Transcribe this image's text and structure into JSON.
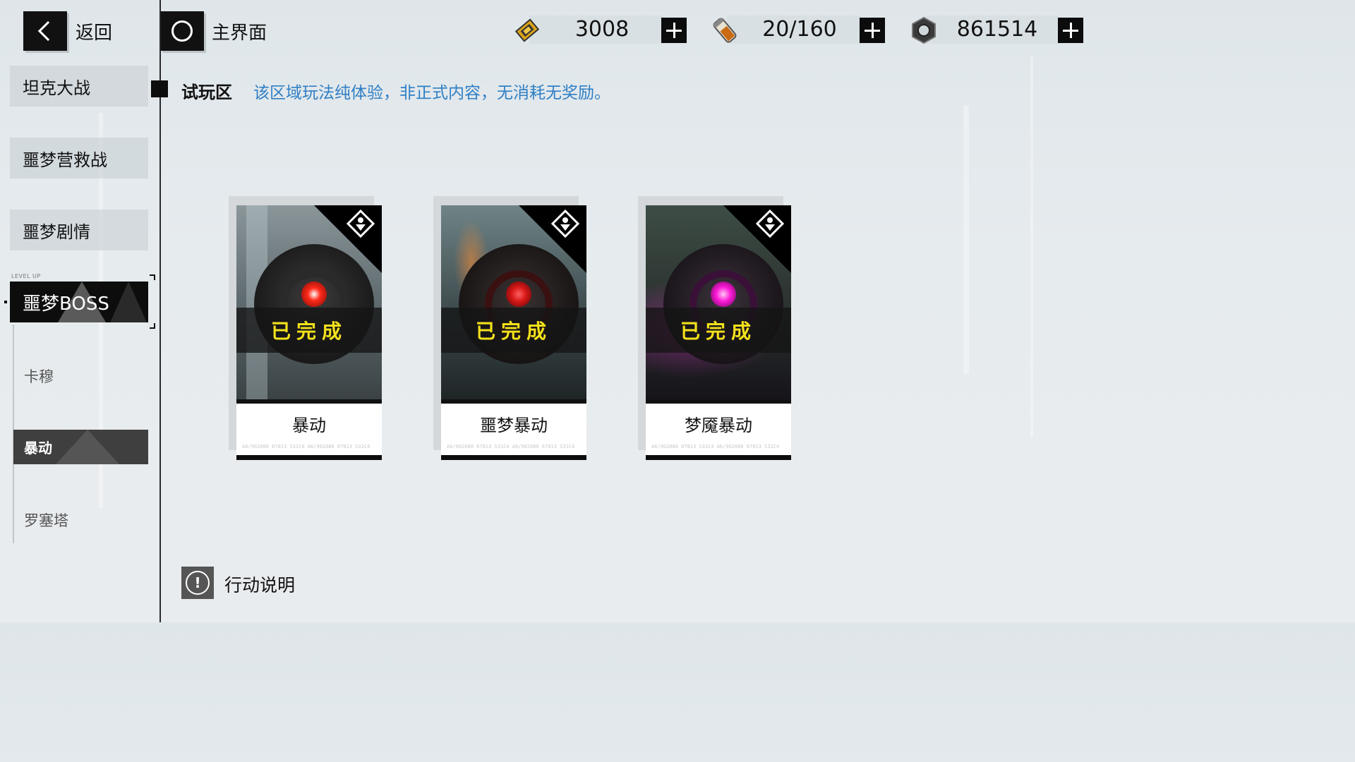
{
  "header": {
    "back_label": "返回",
    "home_label": "主界面",
    "resources": [
      {
        "name": "ticket",
        "icon": "ticket-icon",
        "value": "3008"
      },
      {
        "name": "stamina-vial",
        "icon": "vial-icon",
        "value": "20/160"
      },
      {
        "name": "hex-nut",
        "icon": "hex-nut-icon",
        "value": "861514"
      }
    ]
  },
  "sidebar": {
    "items": [
      {
        "label": "坦克大战"
      },
      {
        "label": "噩梦营救战"
      },
      {
        "label": "噩梦剧情"
      },
      {
        "label": "噩梦BOSS",
        "active": true,
        "tag": "LEVEL UP"
      }
    ],
    "subitems": [
      {
        "label": "卡穆"
      },
      {
        "label": "暴动",
        "active": true
      },
      {
        "label": "罗塞塔"
      }
    ]
  },
  "section": {
    "title": "试玩区",
    "note": "该区域玩法纯体验，非正式内容，无消耗无奖励。"
  },
  "cards": [
    {
      "name": "暴动",
      "status": "已完成",
      "eye_color": "#ff2a1a",
      "code": "A6/902088 67813 S31C4 A6/902088 67813 S31C4"
    },
    {
      "name": "噩梦暴动",
      "status": "已完成",
      "eye_color": "#d81818",
      "code": "A6/902088 67813 S31C4 A6/902088 67813 S31C4"
    },
    {
      "name": "梦魇暴动",
      "status": "已完成",
      "eye_color": "#ff1ad8",
      "code": "A6/902088 67813 S31C4 A6/902088 67813 S31C4"
    }
  ],
  "footer": {
    "help_label": "行动说明"
  },
  "colors": {
    "accent_blue": "#2f7fc4",
    "done_yellow": "#f3e11c",
    "dark": "#0d0d0d"
  }
}
